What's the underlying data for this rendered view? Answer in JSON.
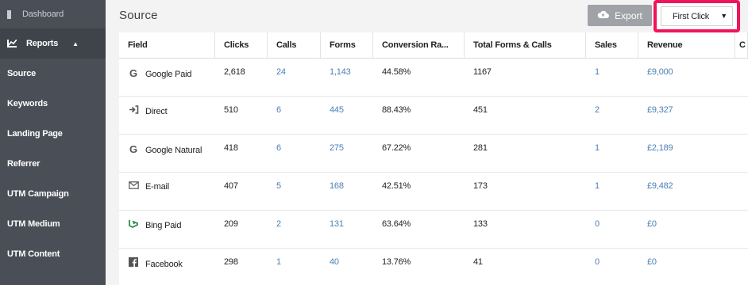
{
  "sidebar": {
    "dashboard_label": "Dashboard",
    "reports_label": "Reports",
    "items": [
      {
        "label": "Source"
      },
      {
        "label": "Keywords"
      },
      {
        "label": "Landing Page"
      },
      {
        "label": "Referrer"
      },
      {
        "label": "UTM Campaign"
      },
      {
        "label": "UTM Medium"
      },
      {
        "label": "UTM Content"
      }
    ]
  },
  "header": {
    "title": "Source",
    "export_label": "Export",
    "attribution_selected": "First Click"
  },
  "table": {
    "headers": [
      "Field",
      "Clicks",
      "Calls",
      "Forms",
      "Conversion Ra...",
      "Total Forms & Calls",
      "Sales",
      "Revenue",
      "C"
    ],
    "rows": [
      {
        "icon": "google-icon",
        "field": "Google Paid",
        "clicks": "2,618",
        "calls": "24",
        "forms": "1,143",
        "conversion": "44.58%",
        "total": "1167",
        "sales": "1",
        "revenue": "£9,000"
      },
      {
        "icon": "direct-arrow-icon",
        "field": "Direct",
        "clicks": "510",
        "calls": "6",
        "forms": "445",
        "conversion": "88.43%",
        "total": "451",
        "sales": "2",
        "revenue": "£9,327"
      },
      {
        "icon": "google-icon",
        "field": "Google Natural",
        "clicks": "418",
        "calls": "6",
        "forms": "275",
        "conversion": "67.22%",
        "total": "281",
        "sales": "1",
        "revenue": "£2,189"
      },
      {
        "icon": "envelope-icon",
        "field": "E-mail",
        "clicks": "407",
        "calls": "5",
        "forms": "168",
        "conversion": "42.51%",
        "total": "173",
        "sales": "1",
        "revenue": "£9,482"
      },
      {
        "icon": "bing-icon",
        "field": "Bing Paid",
        "clicks": "209",
        "calls": "2",
        "forms": "131",
        "conversion": "63.64%",
        "total": "133",
        "sales": "0",
        "revenue": "£0"
      },
      {
        "icon": "facebook-icon",
        "field": "Facebook",
        "clicks": "298",
        "calls": "1",
        "forms": "40",
        "conversion": "13.76%",
        "total": "41",
        "sales": "0",
        "revenue": "£0"
      }
    ]
  },
  "colors": {
    "sidebar_bg": "#4a4f57",
    "link": "#4a7fb5",
    "highlight": "#f0145a",
    "export_btn": "#9fa2a6"
  }
}
